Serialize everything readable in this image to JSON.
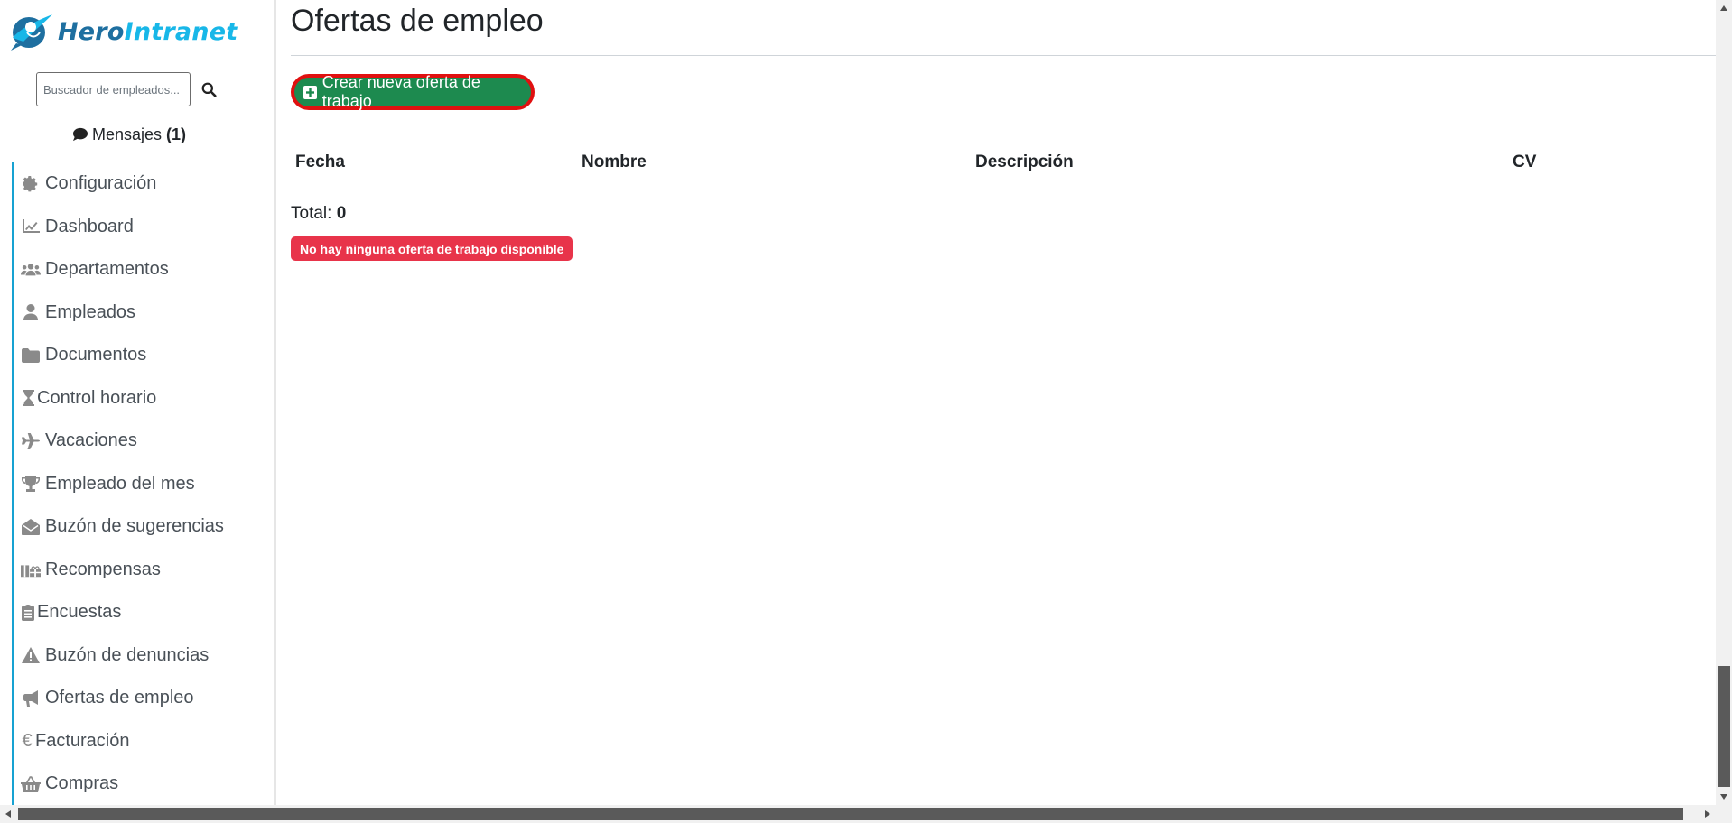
{
  "brand": {
    "hero": "Hero",
    "intranet": "Intranet"
  },
  "search": {
    "placeholder": "Buscador de empleados..."
  },
  "messages": {
    "label": "Mensajes",
    "count": "(1)"
  },
  "sidebar": {
    "items": [
      {
        "label": "Configuración",
        "icon": "gear-icon"
      },
      {
        "label": "Dashboard",
        "icon": "chart-line-icon"
      },
      {
        "label": "Departamentos",
        "icon": "users-icon"
      },
      {
        "label": "Empleados",
        "icon": "user-icon"
      },
      {
        "label": "Documentos",
        "icon": "folder-icon"
      },
      {
        "label": "Control horario",
        "icon": "hourglass-icon"
      },
      {
        "label": "Vacaciones",
        "icon": "plane-icon"
      },
      {
        "label": "Empleado del mes",
        "icon": "trophy-icon"
      },
      {
        "label": "Buzón de sugerencias",
        "icon": "envelope-open-icon"
      },
      {
        "label": "Recompensas",
        "icon": "gifts-icon"
      },
      {
        "label": "Encuestas",
        "icon": "clipboard-list-icon"
      },
      {
        "label": "Buzón de denuncias",
        "icon": "warning-icon"
      },
      {
        "label": "Ofertas de empleo",
        "icon": "megaphone-icon"
      },
      {
        "label": "Facturación",
        "icon": "euro-icon"
      },
      {
        "label": "Compras",
        "icon": "basket-icon"
      }
    ]
  },
  "main": {
    "title": "Ofertas de empleo",
    "create_button": "Crear nueva oferta de trabajo",
    "table": {
      "headers": [
        "Fecha",
        "Nombre",
        "Descripción",
        "CV"
      ],
      "rows": []
    },
    "total_label": "Total:",
    "total_value": "0",
    "empty_badge": "No hay ninguna oferta de trabajo disponible"
  },
  "colors": {
    "accent": "#17a2d2",
    "success": "#1d8a4f",
    "danger": "#e8344a",
    "highlight_ring": "#e01010"
  }
}
